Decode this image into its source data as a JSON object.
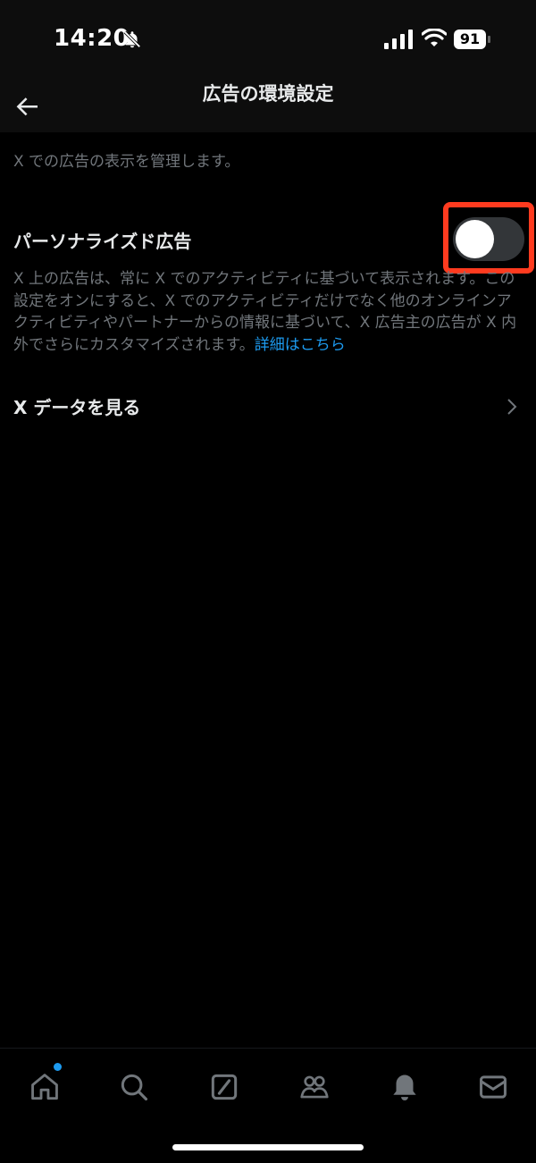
{
  "status_bar": {
    "time": "14:20",
    "battery": "91",
    "icons": [
      "bell-slash-icon",
      "cellular-signal-icon",
      "wifi-icon",
      "battery-icon"
    ]
  },
  "header": {
    "title": "広告の環境設定",
    "back_icon": "arrow-left-icon"
  },
  "intro_text": "X での広告の表示を管理します。",
  "personalized_ads": {
    "title": "パーソナライズド広告",
    "toggle_on": false,
    "description": "X 上の広告は、常に X でのアクティビティに基づいて表示されます。この設定をオンにすると、X でのアクティビティだけでなく他のオンラインアクティビティやパートナーからの情報に基づいて、X 広告主の広告が X 内外でさらにカスタマイズされます。",
    "learn_more": "詳細はこちら"
  },
  "x_data_row": {
    "label": "X データを見る",
    "icon": "chevron-right-icon"
  },
  "tab_bar": {
    "tabs": [
      "home-icon",
      "search-icon",
      "grok-icon",
      "communities-icon",
      "notifications-icon",
      "messages-icon"
    ],
    "home_badge": true
  },
  "colors": {
    "accent": "#1d9bf0",
    "highlight": "#ff3b1f",
    "secondary_text": "#71767b",
    "primary_text": "#e7e9ea"
  }
}
